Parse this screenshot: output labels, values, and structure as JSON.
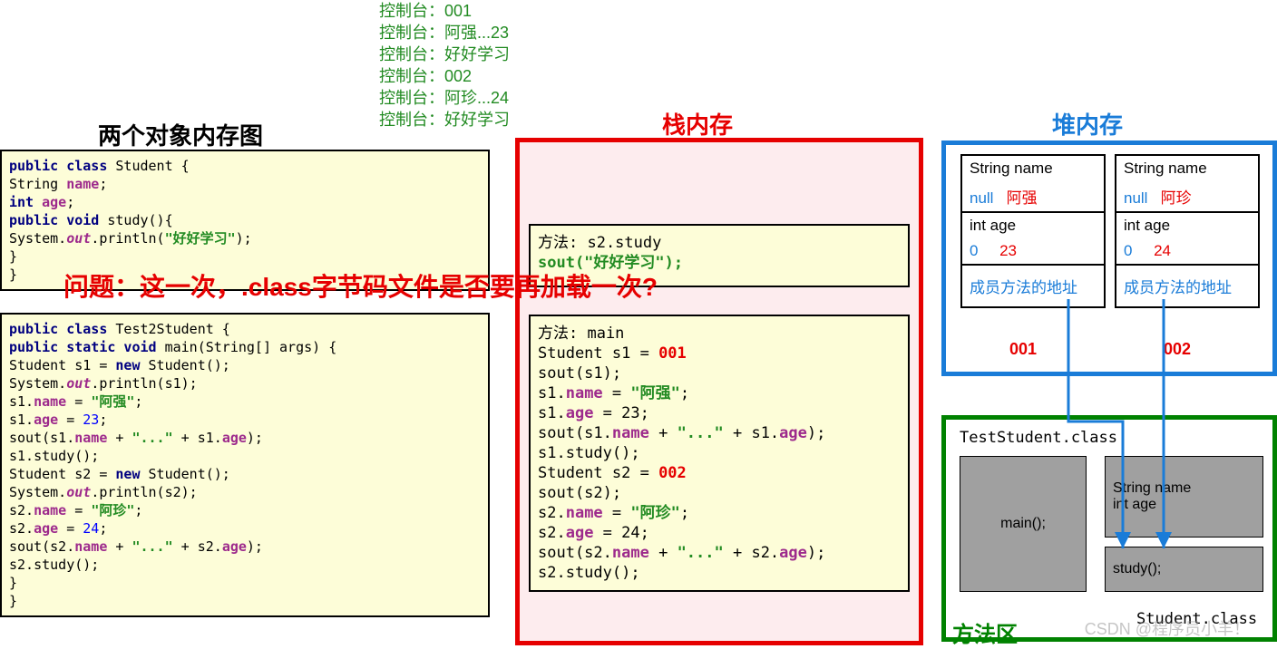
{
  "console": {
    "lines": [
      "控制台：001",
      "控制台：阿强...23",
      "控制台：好好学习",
      "控制台：002",
      "控制台：阿珍...24",
      "控制台：好好学习"
    ]
  },
  "titles": {
    "left": "两个对象内存图",
    "stack": "栈内存",
    "heap": "堆内存",
    "method": "方法区"
  },
  "codeA": {
    "l1a": "public class ",
    "l1b": "Student {",
    "l2a": "    String ",
    "l2b": "name",
    "l2c": ";",
    "l3a": "    int ",
    "l3b": "age",
    "l3c": ";",
    "l4a": "    public void ",
    "l4b": "study(){",
    "l5a": "        System.",
    "l5b": "out",
    "l5c": ".println(",
    "l5d": "\"好好学习\"",
    "l5e": ");",
    "l6": "    }",
    "l7": "}"
  },
  "codeB": {
    "l1a": "public class ",
    "l1b": "Test2Student {",
    "l2a": "    public static void ",
    "l2b": "main(String[] args) {",
    "l3a": "        Student s1 = ",
    "l3b": "new ",
    "l3c": "Student();",
    "l4a": "        System.",
    "l4b": "out",
    "l4c": ".println(s1);",
    "l5a": "        s1.",
    "l5b": "name ",
    "l5c": "= ",
    "l5d": "\"阿强\"",
    "l5e": ";",
    "l6a": "        s1.",
    "l6b": "age ",
    "l6c": "= ",
    "l6d": "23",
    "l6e": ";",
    "l7a": "        sout(s1.",
    "l7b": "name ",
    "l7c": "+ ",
    "l7d": "\"...\" ",
    "l7e": "+ s1.",
    "l7f": "age",
    "l7g": ");",
    "l8": "        s1.study();",
    "l9a": "        Student s2 = ",
    "l9b": "new ",
    "l9c": "Student();",
    "l10a": "        System.",
    "l10b": "out",
    "l10c": ".println(s2);",
    "l11a": "        s2.",
    "l11b": "name ",
    "l11c": "= ",
    "l11d": "\"阿珍\"",
    "l11e": ";",
    "l12a": "        s2.",
    "l12b": "age ",
    "l12c": "= ",
    "l12d": "24",
    "l12e": ";",
    "l13a": "        sout(s2.",
    "l13b": "name ",
    "l13c": "+ ",
    "l13d": "\"...\" ",
    "l13e": "+ s2.",
    "l13f": "age",
    "l13g": ");",
    "l14": "        s2.study();",
    "l15": "    }",
    "l16": "}"
  },
  "stack": {
    "frameA": {
      "title": "方法: s2.study",
      "body": "sout(\"好好学习\");"
    },
    "frameB": {
      "title": "方法: main",
      "l1a": "Student s1 = ",
      "l1b": "001",
      "l2": "sout(s1);",
      "l3a": "s1.",
      "l3b": "name",
      "l3c": " = ",
      "l3d": "\"阿强\"",
      "l3e": ";",
      "l4a": "s1.",
      "l4b": "age",
      "l4c": " = 23;",
      "l5a": "sout(s1.",
      "l5b": "name",
      "l5c": " + ",
      "l5d": "\"...\"",
      "l5e": " + s1.",
      "l5f": "age",
      "l5g": ");",
      "l6": "s1.study();",
      "l7a": "Student s2 = ",
      "l7b": "002",
      "l8": "sout(s2);",
      "l9a": "s2.",
      "l9b": "name",
      "l9c": " = ",
      "l9d": "\"阿珍\"",
      "l9e": ";",
      "l10a": "s2.",
      "l10b": "age",
      "l10c": " = 24;",
      "l11a": "sout(s2.",
      "l11b": "name",
      "l11c": " + ",
      "l11d": "\"...\"",
      "l11e": " + s2.",
      "l11f": "age",
      "l11g": ");",
      "l12": "s2.study();"
    }
  },
  "heap": {
    "obj1": {
      "nameLabel": "String name",
      "nameNull": "null",
      "nameVal": "阿强",
      "ageLabel": "int age",
      "ageZero": "0",
      "ageVal": "23",
      "methods": "成员方法的地址",
      "addr": "001"
    },
    "obj2": {
      "nameLabel": "String name",
      "nameNull": "null",
      "nameVal": "阿珍",
      "ageLabel": "int age",
      "ageZero": "0",
      "ageVal": "24",
      "methods": "成员方法的地址",
      "addr": "002"
    }
  },
  "question": "问题：这一次，.class字节码文件是否要再加载一次?",
  "methodArea": {
    "testClass": "TestStudent.class",
    "studentClass": "Student.class",
    "main": "main();",
    "nameField": "String name",
    "ageField": "int age",
    "study": "study();"
  },
  "watermark": "CSDN @程序员小羊！"
}
